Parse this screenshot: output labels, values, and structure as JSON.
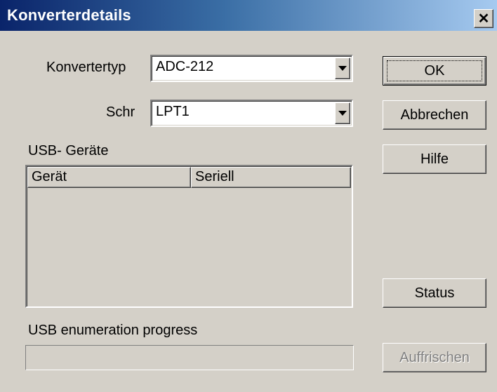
{
  "window": {
    "title": "Konverterdetails",
    "close_glyph": "✕"
  },
  "form": {
    "converter_type": {
      "label": "Konvertertyp",
      "value": "ADC-212"
    },
    "port": {
      "label": "Schr",
      "value": "LPT1"
    }
  },
  "usb_devices": {
    "label": "USB- Geräte",
    "columns": [
      "Gerät",
      "Seriell"
    ],
    "rows": []
  },
  "progress": {
    "label": "USB enumeration progress",
    "fraction": 0
  },
  "buttons": {
    "ok": "OK",
    "cancel": "Abbrechen",
    "help": "Hilfe",
    "status": "Status",
    "refresh": "Auffrischen"
  },
  "colors": {
    "dialog_bg": "#d4d0c8",
    "title_start": "#0a246a",
    "title_end": "#a6caf0",
    "disabled_text": "#808080"
  }
}
